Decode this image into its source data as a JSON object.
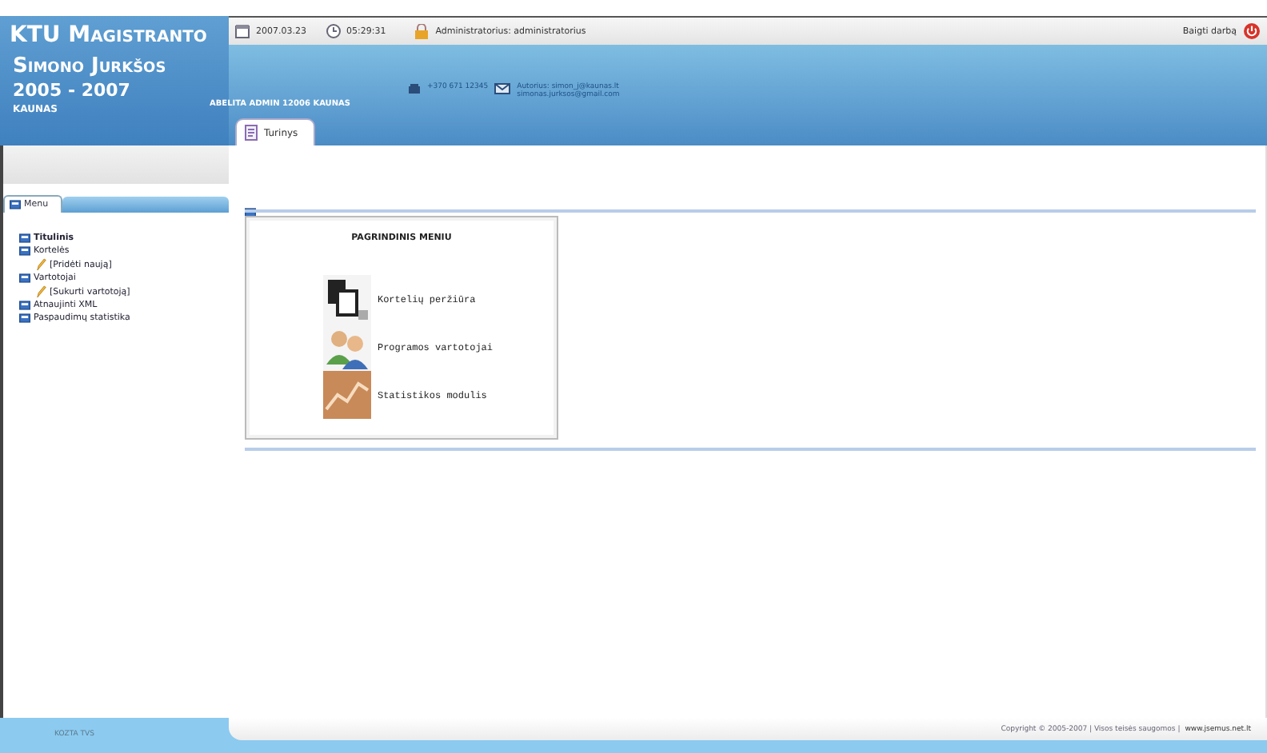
{
  "brand": {
    "title": "KTU Magistranto",
    "subtitle": "Simono Jurkšos",
    "years": "2005 - 2007",
    "city": "KAUNAS"
  },
  "top_bar": {
    "date": "2007.03.23",
    "time": "05:29:31",
    "user": "Administratorius: administratorius",
    "logout": "Baigti darbą"
  },
  "header": {
    "address": "ABELITA ADMIN 12006 KAUNAS",
    "phone": "+370 671 12345",
    "email_lines": [
      "Autorius: simon_j@kaunas.lt",
      "simonas.jurksos@gmail.com"
    ]
  },
  "tabs": [
    {
      "label": "Turinys",
      "selected": true
    }
  ],
  "sidebar": {
    "tab": "Menu",
    "items": [
      {
        "label": "Titulinis",
        "selected": true
      },
      {
        "label": "Kortelės",
        "selected": false,
        "children": [
          {
            "label": "[Pridėti naują]",
            "selected": false
          }
        ]
      },
      {
        "label": "Vartotojai",
        "selected": false,
        "children": [
          {
            "label": "[Sukurti vartotoją]",
            "selected": false
          }
        ]
      },
      {
        "label": "Atnaujinti XML",
        "selected": false
      },
      {
        "label": "Paspaudimų statistika",
        "selected": false
      }
    ]
  },
  "main_menu": {
    "title": "PAGRINDINIS MENIU",
    "items": [
      {
        "kind": "cards",
        "label": "Kortelių peržiūra"
      },
      {
        "kind": "users",
        "label": "Programos vartotojai"
      },
      {
        "kind": "stats",
        "label": "Statistikos modulis"
      }
    ]
  },
  "footer": {
    "left": "KOZTA TVS",
    "copyright": "Copyright © 2005-2007 | Visos teisės saugomos |",
    "site": "www.jsemus.net.lt"
  }
}
